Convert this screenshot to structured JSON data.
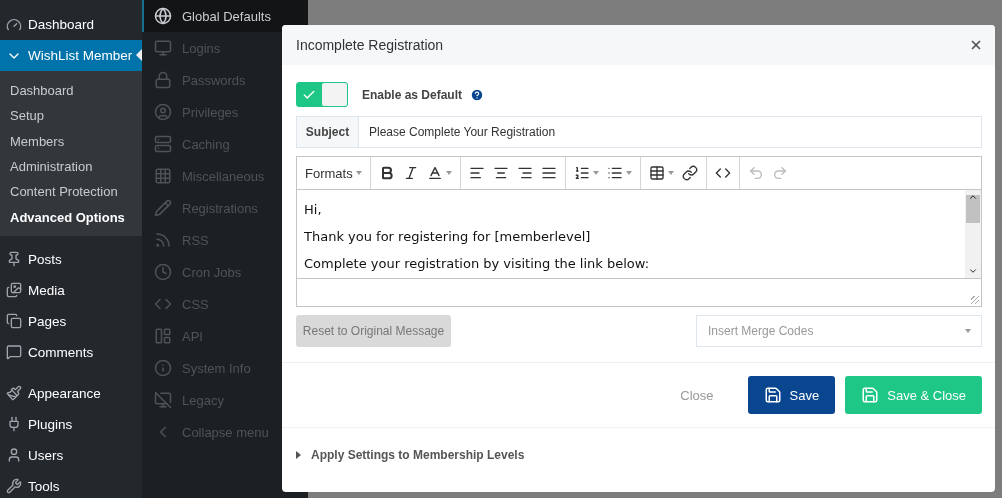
{
  "admin_menu": {
    "items": [
      {
        "label": "Dashboard",
        "selected": false
      },
      {
        "label": "WishList Member",
        "selected": true,
        "expanded": true,
        "children": [
          {
            "label": "Dashboard",
            "selected": false
          },
          {
            "label": "Setup",
            "selected": false
          },
          {
            "label": "Members",
            "selected": false
          },
          {
            "label": "Administration",
            "selected": false
          },
          {
            "label": "Content Protection",
            "selected": false
          },
          {
            "label": "Advanced Options",
            "selected": true
          }
        ]
      },
      {
        "label": "Posts",
        "selected": false
      },
      {
        "label": "Media",
        "selected": false
      },
      {
        "label": "Pages",
        "selected": false
      },
      {
        "label": "Comments",
        "selected": false
      },
      {
        "label": "Appearance",
        "selected": false
      },
      {
        "label": "Plugins",
        "selected": false
      },
      {
        "label": "Users",
        "selected": false
      },
      {
        "label": "Tools",
        "selected": false
      }
    ]
  },
  "plugin_nav": {
    "items": [
      {
        "label": "Global Defaults",
        "selected": true
      },
      {
        "label": "Logins",
        "selected": false
      },
      {
        "label": "Passwords",
        "selected": false
      },
      {
        "label": "Privileges",
        "selected": false
      },
      {
        "label": "Caching",
        "selected": false
      },
      {
        "label": "Miscellaneous",
        "selected": false
      },
      {
        "label": "Registrations",
        "selected": false
      },
      {
        "label": "RSS",
        "selected": false
      },
      {
        "label": "Cron Jobs",
        "selected": false
      },
      {
        "label": "CSS",
        "selected": false
      },
      {
        "label": "API",
        "selected": false
      },
      {
        "label": "System Info",
        "selected": false
      },
      {
        "label": "Legacy",
        "selected": false
      },
      {
        "label": "Collapse menu",
        "selected": false
      }
    ]
  },
  "modal": {
    "title": "Incomplete Registration",
    "toggle": {
      "label": "Enable as Default",
      "on": true
    },
    "subject": {
      "label": "Subject",
      "value": "Please Complete Your Registration"
    },
    "toolbar": {
      "formats": "Formats",
      "history_disabled": true
    },
    "body": [
      "Hi,",
      "Thank you for registering for [memberlevel]",
      "Complete your registration by visiting the link below:"
    ],
    "reset_button": "Reset to Original Message",
    "merge_codes": {
      "placeholder": "Insert Merge Codes"
    },
    "buttons": [
      {
        "label": "Close",
        "kind": "link"
      },
      {
        "label": "Save",
        "kind": "primary"
      },
      {
        "label": "Save & Close",
        "kind": "success"
      }
    ],
    "accordion": {
      "label": "Apply Settings to Membership Levels",
      "expanded": false
    }
  }
}
